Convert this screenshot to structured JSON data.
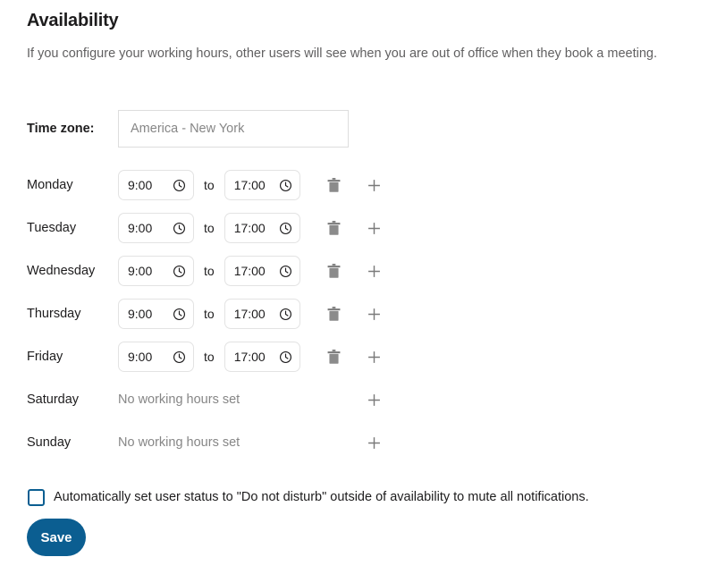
{
  "page": {
    "heading": "Availability",
    "description": "If you configure your working hours, other users will see when you are out of office when they book a meeting."
  },
  "timezone": {
    "label": "Time zone:",
    "value": "",
    "placeholder": "America - New York"
  },
  "labels": {
    "to": "to",
    "no_hours": "No working hours set"
  },
  "icons": {
    "clock": "clock-icon",
    "trash": "trash-icon",
    "plus": "plus-icon"
  },
  "days": [
    {
      "name": "Monday",
      "has_hours": true,
      "start": "9:00",
      "end": "17:00"
    },
    {
      "name": "Tuesday",
      "has_hours": true,
      "start": "9:00",
      "end": "17:00"
    },
    {
      "name": "Wednesday",
      "has_hours": true,
      "start": "9:00",
      "end": "17:00"
    },
    {
      "name": "Thursday",
      "has_hours": true,
      "start": "9:00",
      "end": "17:00"
    },
    {
      "name": "Friday",
      "has_hours": true,
      "start": "9:00",
      "end": "17:00"
    },
    {
      "name": "Saturday",
      "has_hours": false,
      "start": "",
      "end": ""
    },
    {
      "name": "Sunday",
      "has_hours": false,
      "start": "",
      "end": ""
    }
  ],
  "dnd": {
    "checked": false,
    "label": "Automatically set user status to \"Do not disturb\" outside of availability to mute all notifications."
  },
  "save": {
    "label": "Save"
  },
  "colors": {
    "accent": "#0b5e91",
    "text": "#1d1c1d",
    "muted": "#868686",
    "border": "#e3e3e3"
  }
}
